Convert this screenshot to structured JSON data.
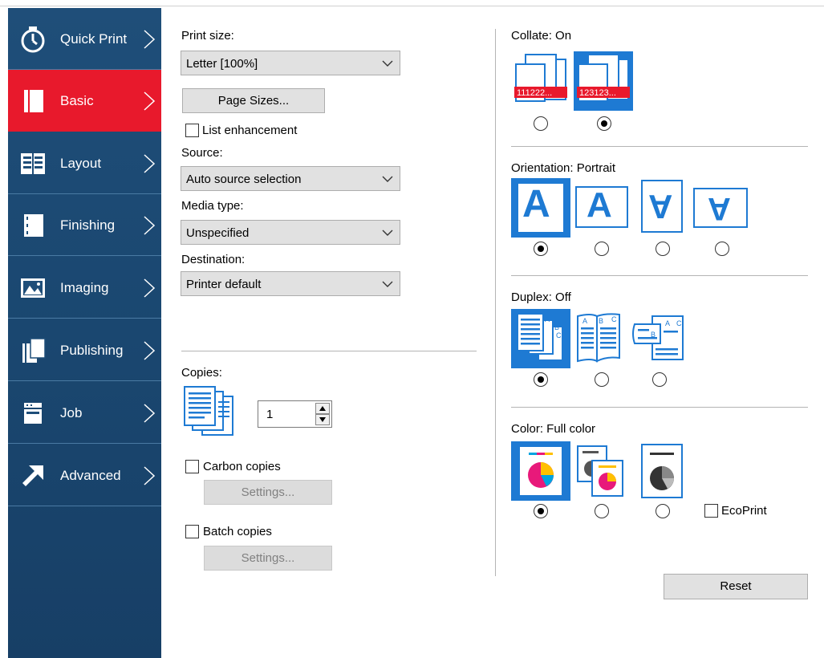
{
  "sidebar": {
    "items": [
      {
        "label": "Quick Print",
        "icon": "stopwatch-icon",
        "active": false
      },
      {
        "label": "Basic",
        "icon": "page-icon",
        "active": true
      },
      {
        "label": "Layout",
        "icon": "layout-grid-icon",
        "active": false
      },
      {
        "label": "Finishing",
        "icon": "finishing-page-icon",
        "active": false
      },
      {
        "label": "Imaging",
        "icon": "image-icon",
        "active": false
      },
      {
        "label": "Publishing",
        "icon": "publishing-pages-icon",
        "active": false
      },
      {
        "label": "Job",
        "icon": "job-box-icon",
        "active": false
      },
      {
        "label": "Advanced",
        "icon": "arrow-upright-icon",
        "active": false
      }
    ]
  },
  "basic": {
    "print_size_label": "Print size:",
    "print_size_value": "Letter  [100%]",
    "page_sizes_button": "Page Sizes...",
    "list_enhancement_label": "List enhancement",
    "source_label": "Source:",
    "source_value": "Auto source selection",
    "media_type_label": "Media type:",
    "media_type_value": "Unspecified",
    "destination_label": "Destination:",
    "destination_value": "Printer default",
    "copies_label": "Copies:",
    "copies_value": "1",
    "carbon_copies_label": "Carbon copies",
    "carbon_settings_button": "Settings...",
    "batch_copies_label": "Batch copies",
    "batch_settings_button": "Settings..."
  },
  "right": {
    "collate_label": "Collate:  On",
    "collate_selected": 1,
    "collate_icon_texts": [
      "111222...",
      "123123..."
    ],
    "orientation_label": "Orientation:  Portrait",
    "orientation_selected": 0,
    "orientation_letter": "A",
    "duplex_label": "Duplex:  Off",
    "duplex_selected": 0,
    "duplex_page_letters": [
      "A",
      "B",
      "C"
    ],
    "color_label": "Color:  Full color",
    "color_selected": 0,
    "ecoprint_label": "EcoPrint",
    "reset_button": "Reset"
  },
  "colors": {
    "sidebar_bg": "#1f4e79",
    "active_red": "#e8192c",
    "selection_blue": "#1e7ad3",
    "icon_blue": "#1e7ad3"
  }
}
